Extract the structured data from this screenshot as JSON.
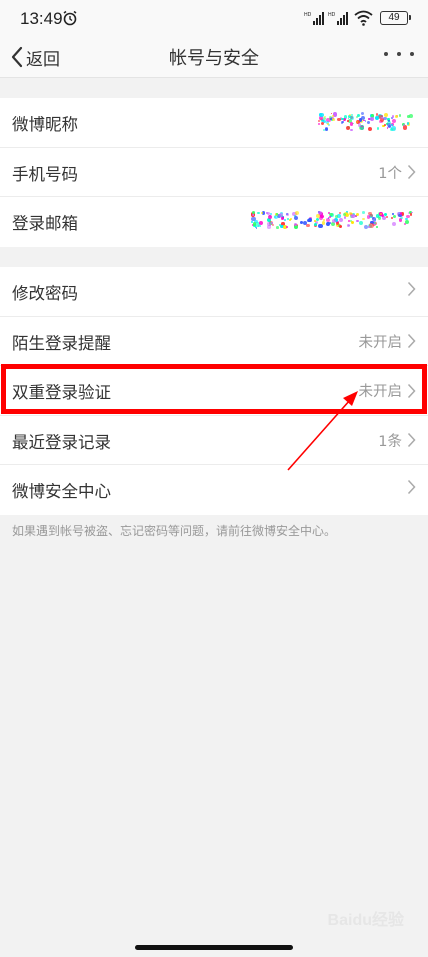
{
  "status_bar": {
    "time": "13:49",
    "battery": "49",
    "signal_badge_1": "HD",
    "signal_badge_2": "HD"
  },
  "nav": {
    "back_label": "返回",
    "title": "帐号与安全"
  },
  "group1": [
    {
      "label": "微博昵称",
      "value": ""
    },
    {
      "label": "手机号码",
      "value": "1个"
    },
    {
      "label": "登录邮箱",
      "value": ""
    }
  ],
  "group2": [
    {
      "label": "修改密码",
      "value": ""
    },
    {
      "label": "陌生登录提醒",
      "value": "未开启"
    },
    {
      "label": "双重登录验证",
      "value": "未开启"
    },
    {
      "label": "最近登录记录",
      "value": "1条"
    },
    {
      "label": "微博安全中心",
      "value": ""
    }
  ],
  "footer_note": "如果遇到帐号被盗、忘记密码等问题，请前往微博安全中心。",
  "watermark": "Baidu经验",
  "colors": {
    "highlight": "#ff0000",
    "background": "#f2f2f2"
  }
}
